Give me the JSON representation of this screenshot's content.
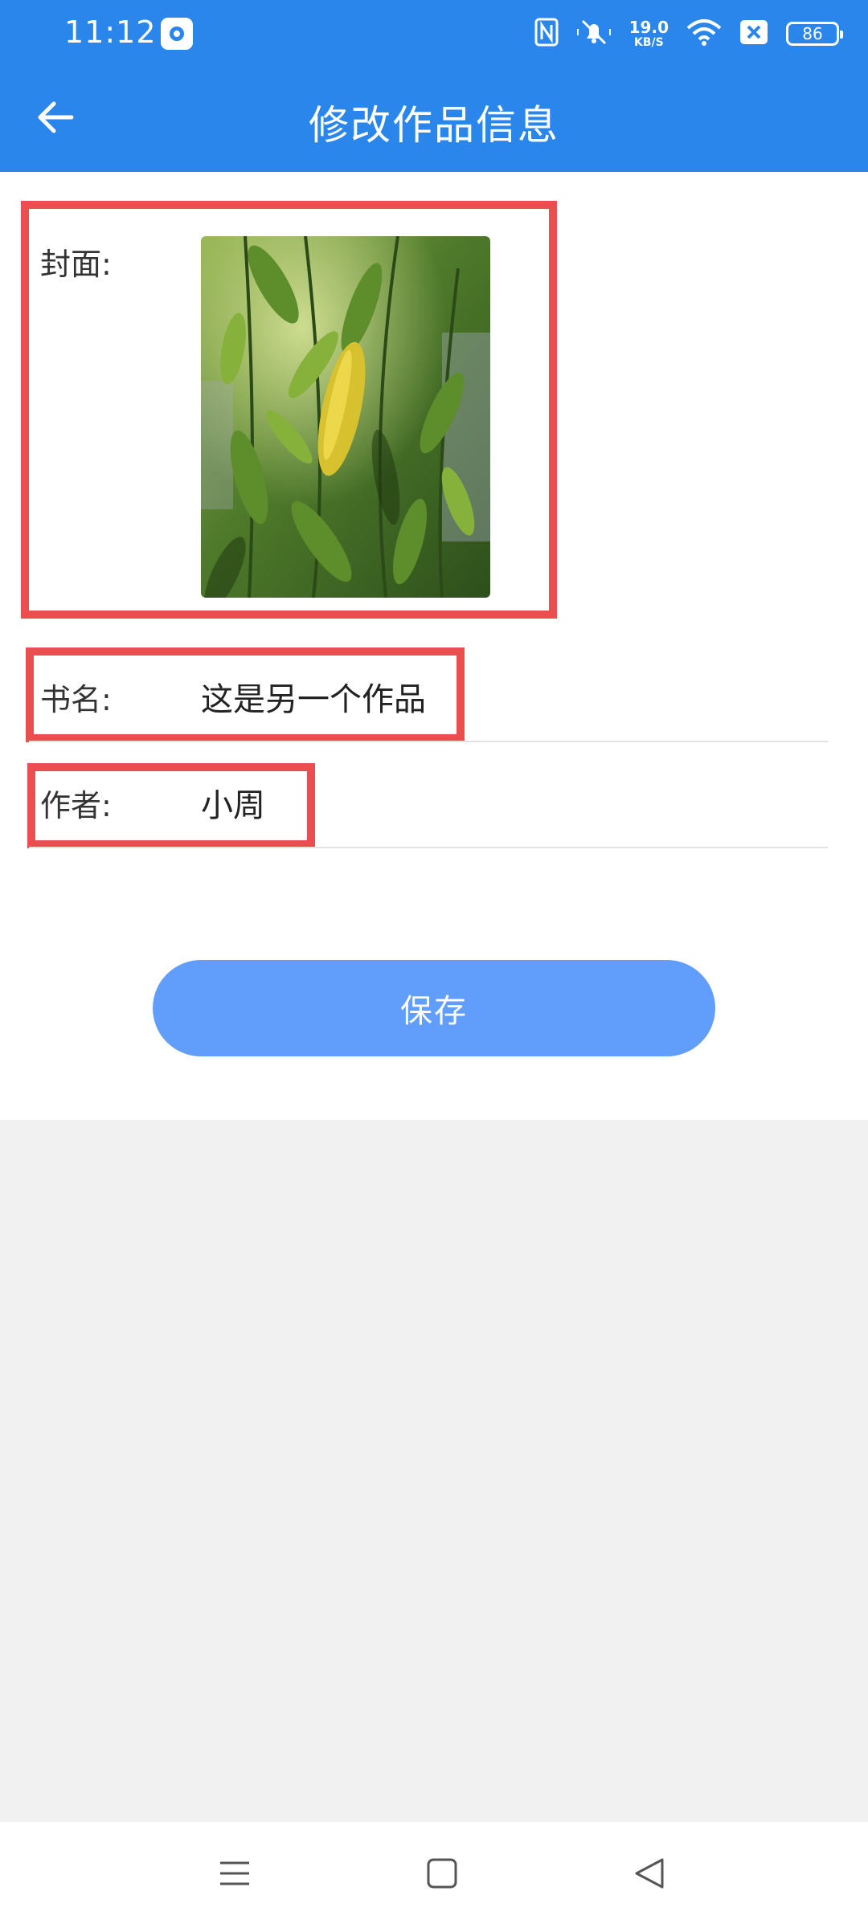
{
  "status_bar": {
    "time": "11:12",
    "net_speed_value": "19.0",
    "net_speed_unit": "KB/S",
    "battery": "86",
    "icons": [
      "app-icon",
      "nfc-icon",
      "mute-icon",
      "wifi-icon",
      "sim-off-icon",
      "battery-icon"
    ]
  },
  "header": {
    "title": "修改作品信息",
    "back_icon": "arrow-left-icon"
  },
  "form": {
    "cover_label": "封面:",
    "title_label": "书名:",
    "title_value": "这是另一个作品",
    "author_label": "作者:",
    "author_value": "小周"
  },
  "actions": {
    "save_label": "保存"
  },
  "colors": {
    "primary": "#2a86ea",
    "button": "#619efb",
    "highlight": "#ea4e4e",
    "background": "#f1f1f1"
  },
  "navigation": {
    "icons": [
      "menu-icon",
      "home-icon",
      "back-triangle-icon"
    ]
  }
}
